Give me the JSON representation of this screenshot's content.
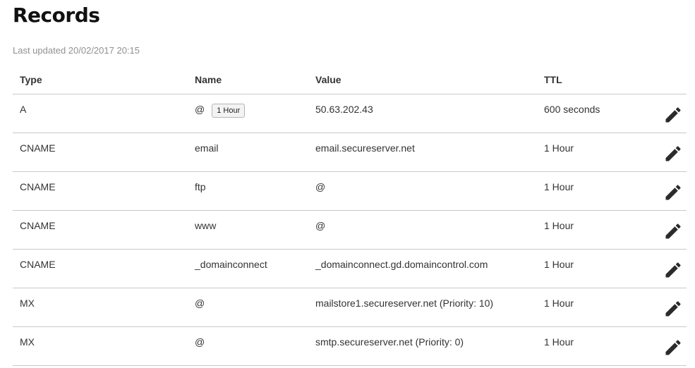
{
  "page": {
    "title": "Records",
    "last_updated": "Last updated 20/02/2017 20:15"
  },
  "table": {
    "headers": {
      "type": "Type",
      "name": "Name",
      "value": "Value",
      "ttl": "TTL"
    },
    "rows": [
      {
        "type": "A",
        "name": "@",
        "name_badge": "1 Hour",
        "value": "50.63.202.43",
        "ttl": "600 seconds",
        "action_icon": "pencil-icon"
      },
      {
        "type": "CNAME",
        "name": "email",
        "value": "email.secureserver.net",
        "ttl": "1 Hour",
        "action_icon": "pencil-icon"
      },
      {
        "type": "CNAME",
        "name": "ftp",
        "value": "@",
        "ttl": "1 Hour",
        "action_icon": "pencil-icon"
      },
      {
        "type": "CNAME",
        "name": "www",
        "value": "@",
        "ttl": "1 Hour",
        "action_icon": "pencil-icon"
      },
      {
        "type": "CNAME",
        "name": "_domainconnect",
        "value": "_domainconnect.gd.domaincontrol.com",
        "ttl": "1 Hour",
        "action_icon": "pencil-icon"
      },
      {
        "type": "MX",
        "name": "@",
        "value": "mailstore1.secureserver.net (Priority: 10)",
        "ttl": "1 Hour",
        "action_icon": "pencil-icon"
      },
      {
        "type": "MX",
        "name": "@",
        "value": "smtp.secureserver.net (Priority: 0)",
        "ttl": "1 Hour",
        "action_icon": "pencil-icon"
      }
    ]
  },
  "colors": {
    "text": "#333333",
    "muted": "#909090",
    "divider": "#c9c9c9",
    "icon": "#2b2b2b"
  }
}
